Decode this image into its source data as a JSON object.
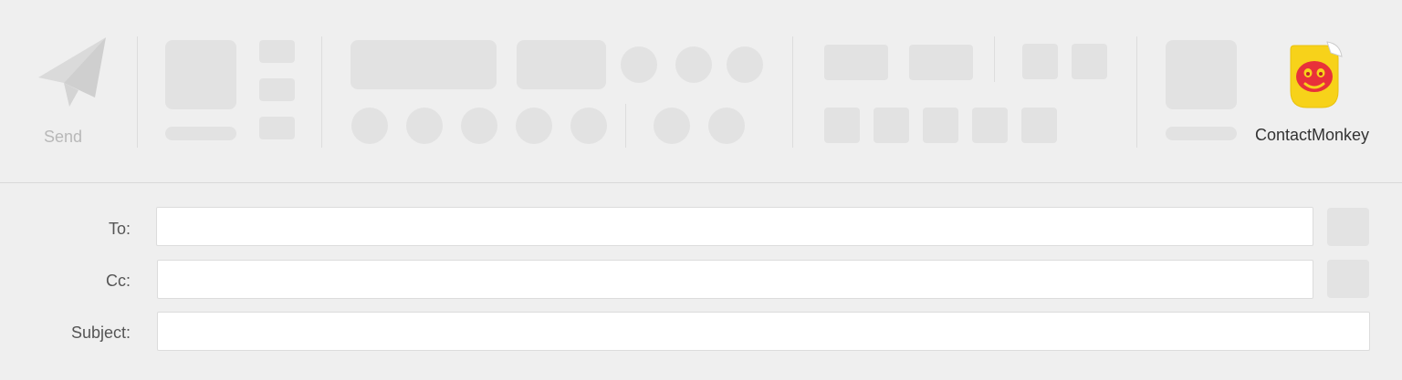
{
  "ribbon": {
    "send_label": "Send",
    "send_icon": "paper-plane-icon",
    "addin": {
      "label": "ContactMonkey",
      "icon": "contactmonkey-logo-icon",
      "badge_color": "#f7d21a",
      "face_color": "#e8313a"
    }
  },
  "fields": {
    "to": {
      "label": "To:",
      "value": ""
    },
    "cc": {
      "label": "Cc:",
      "value": ""
    },
    "subject": {
      "label": "Subject:",
      "value": ""
    }
  }
}
